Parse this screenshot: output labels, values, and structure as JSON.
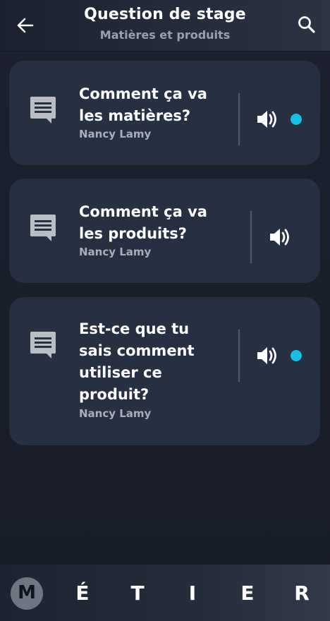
{
  "header": {
    "title": "Question de stage",
    "subtitle": "Matières et produits",
    "back_icon": "arrow-left-icon",
    "search_icon": "search-icon"
  },
  "questions": [
    {
      "line1": "Comment ça va",
      "line2": "les matières?",
      "author": "Nancy Lamy",
      "unread": true
    },
    {
      "line1": "Comment ça va",
      "line2": "les produits?",
      "author": "Nancy Lamy",
      "unread": false
    },
    {
      "line1": "Est-ce que tu",
      "line2": "sais comment",
      "line3": "utiliser ce",
      "line4": "produit?",
      "author": "Nancy Lamy",
      "unread": true
    }
  ],
  "bottom_nav": {
    "letters": [
      "M",
      "É",
      "T",
      "I",
      "E",
      "R"
    ],
    "active_index": 0
  },
  "colors": {
    "background": "#1a1f2b",
    "card": "#273042",
    "unread_dot": "#17bfe2",
    "text_primary": "#ffffff",
    "text_secondary": "#a9afba"
  }
}
